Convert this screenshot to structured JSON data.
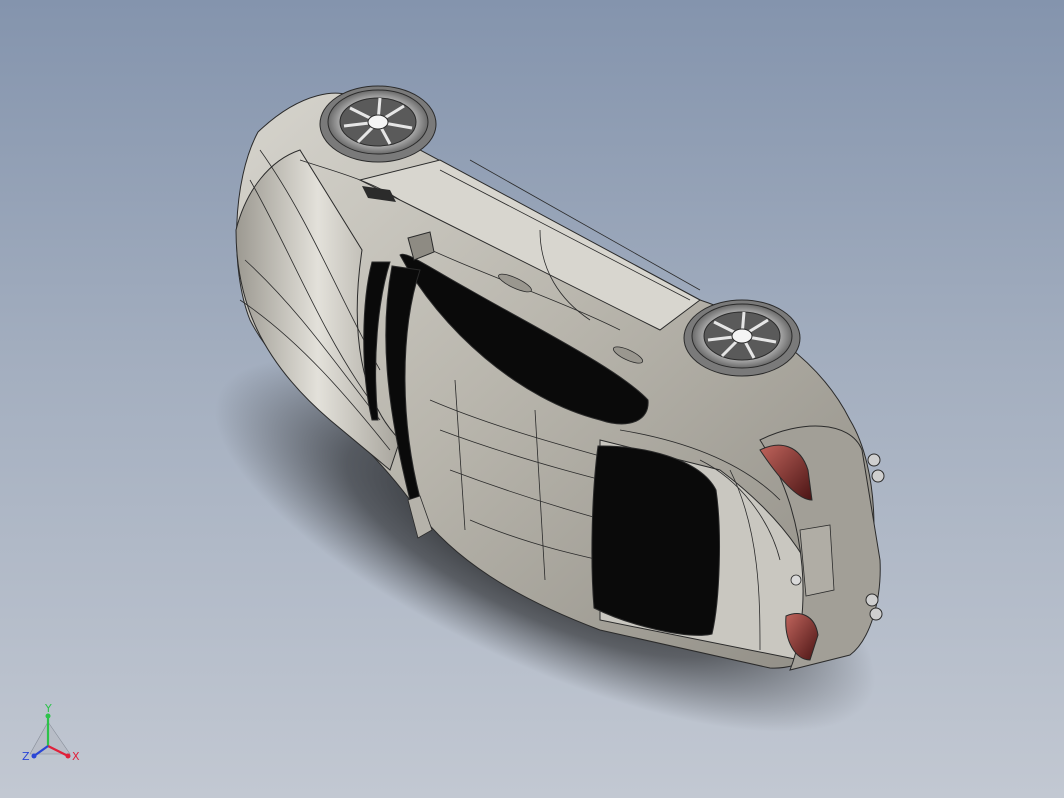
{
  "viewport": {
    "background_top": "#8494ad",
    "background_bottom": "#c2c8d2"
  },
  "model": {
    "body_color": "#b9b6ad",
    "glass_color": "#0a0a0a",
    "taillight_color": "#7a2a28",
    "edge_color": "#2b2b2b"
  },
  "triad": {
    "x_label": "X",
    "y_label": "Y",
    "z_label": "Z",
    "x_color": "#e0203a",
    "y_color": "#2cc24a",
    "z_color": "#2a46d6"
  }
}
